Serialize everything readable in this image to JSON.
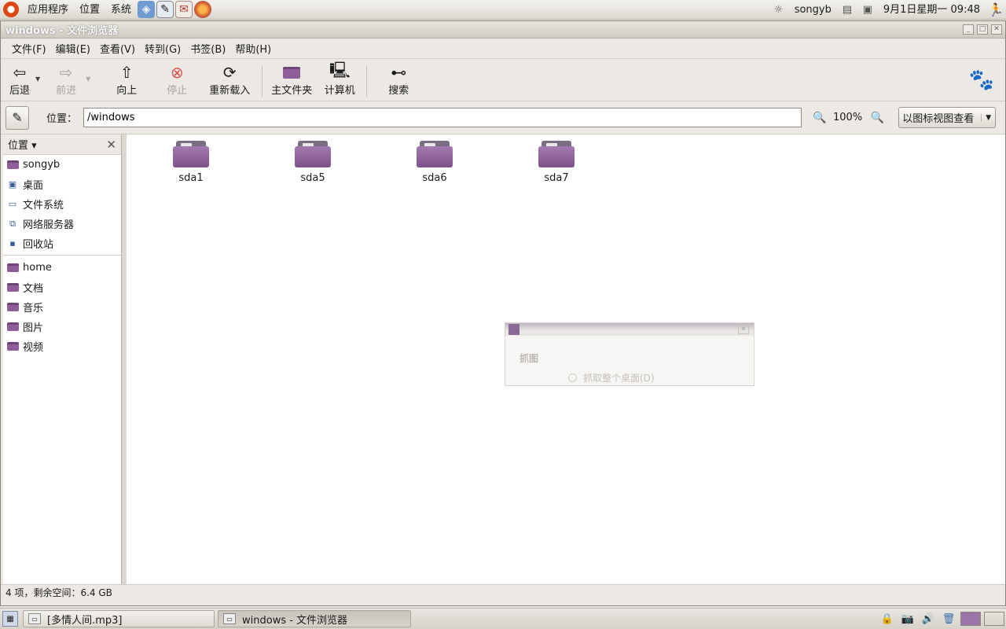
{
  "top_panel": {
    "menus": [
      "应用程序",
      "位置",
      "系统"
    ],
    "launchers": [
      "virtualbox-icon",
      "text-editor-icon",
      "mail-icon",
      "firefox-icon"
    ],
    "user": "songyb",
    "clock": "9月1日星期一 09:48"
  },
  "window": {
    "title": "windows - 文件浏览器",
    "menus": [
      "文件(F)",
      "编辑(E)",
      "查看(V)",
      "转到(G)",
      "书签(B)",
      "帮助(H)"
    ],
    "toolbar": {
      "back": "后退",
      "forward": "前进",
      "up": "向上",
      "stop": "停止",
      "reload": "重新载入",
      "home": "主文件夹",
      "computer": "计算机",
      "search": "搜索"
    },
    "location": {
      "label": "位置：",
      "value": "/windows",
      "zoom": "100%",
      "view_mode": "以图标视图查看"
    },
    "sidebar": {
      "header": "位置",
      "places": [
        {
          "label": "songyb",
          "icon": "home-folder-icon"
        },
        {
          "label": "桌面",
          "icon": "desktop-icon"
        },
        {
          "label": "文件系统",
          "icon": "filesystem-icon"
        },
        {
          "label": "网络服务器",
          "icon": "network-icon"
        },
        {
          "label": "回收站",
          "icon": "trash-icon"
        }
      ],
      "bookmarks": [
        {
          "label": "home",
          "icon": "folder-icon"
        },
        {
          "label": "文档",
          "icon": "folder-icon"
        },
        {
          "label": "音乐",
          "icon": "folder-icon"
        },
        {
          "label": "图片",
          "icon": "folder-icon"
        },
        {
          "label": "视频",
          "icon": "folder-icon"
        }
      ]
    },
    "files": [
      {
        "name": "sda1"
      },
      {
        "name": "sda5"
      },
      {
        "name": "sda6"
      },
      {
        "name": "sda7"
      }
    ],
    "ghost_dialog": {
      "heading": "抓图",
      "option": "抓取整个桌面(D)"
    },
    "status": "4 项，剩余空间：6.4 GB"
  },
  "bottom_panel": {
    "tasks": [
      {
        "label": "[多情人间.mp3]",
        "active": false
      },
      {
        "label": "windows - 文件浏览器",
        "active": true
      }
    ]
  },
  "colors": {
    "folder_purple": "#8e5d9a",
    "panel_bg": "#ece9e5"
  }
}
